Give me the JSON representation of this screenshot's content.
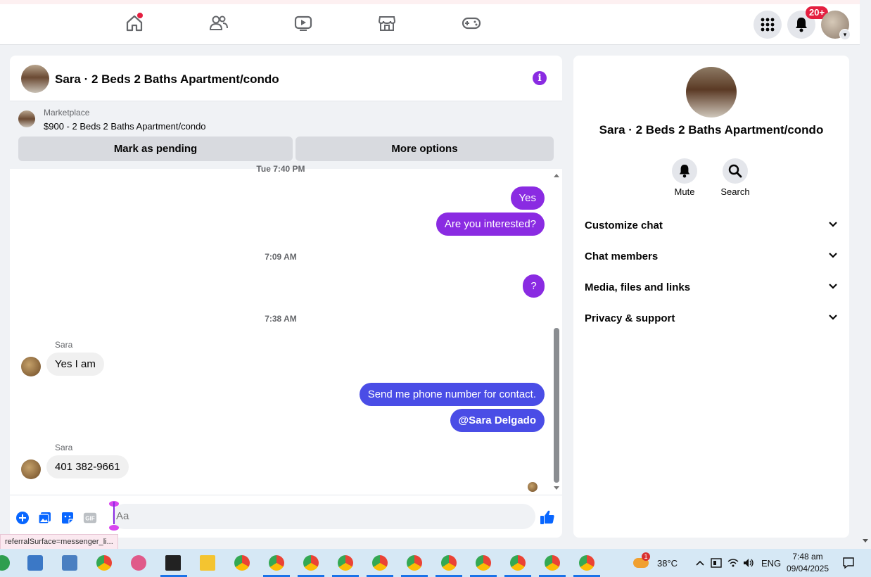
{
  "nav": {
    "notifications_badge": "20+"
  },
  "chat": {
    "title": "Sara · 2 Beds 2 Baths Apartment/condo",
    "marketplace_label": "Marketplace",
    "listing_title": "$900 - 2 Beds 2 Baths Apartment/condo",
    "mark_pending_label": "Mark as pending",
    "more_options_label": "More options",
    "partial_timestamp": "Tue 7:40 PM",
    "messages": [
      {
        "text": "Yes"
      },
      {
        "text": "Are you interested?"
      },
      {
        "timestamp": "7:09 AM"
      },
      {
        "text": "?"
      },
      {
        "timestamp": "7:38 AM"
      },
      {
        "sender": "Sara",
        "text": "Yes I am"
      },
      {
        "text": "Send me phone number for contact."
      },
      {
        "text": "@Sara Delgado"
      },
      {
        "sender": "Sara",
        "text": "401 382-9661"
      }
    ],
    "input_placeholder": "Aa",
    "gif_label": "GIF"
  },
  "info_panel": {
    "title": "Sara · 2 Beds 2 Baths Apartment/condo",
    "mute_label": "Mute",
    "search_label": "Search",
    "sections": [
      "Customize chat",
      "Chat members",
      "Media, files and links",
      "Privacy & support"
    ]
  },
  "tooltip": "referralSurface=messenger_li...",
  "taskbar": {
    "weather_badge": "1",
    "temperature": "38°C",
    "language": "ENG",
    "time": "7:48 am",
    "date": "09/04/2025"
  },
  "colors": {
    "accent_purple": "#8a2be2",
    "accent_blue": "#4a4de6",
    "fb_blue": "#0866ff"
  }
}
